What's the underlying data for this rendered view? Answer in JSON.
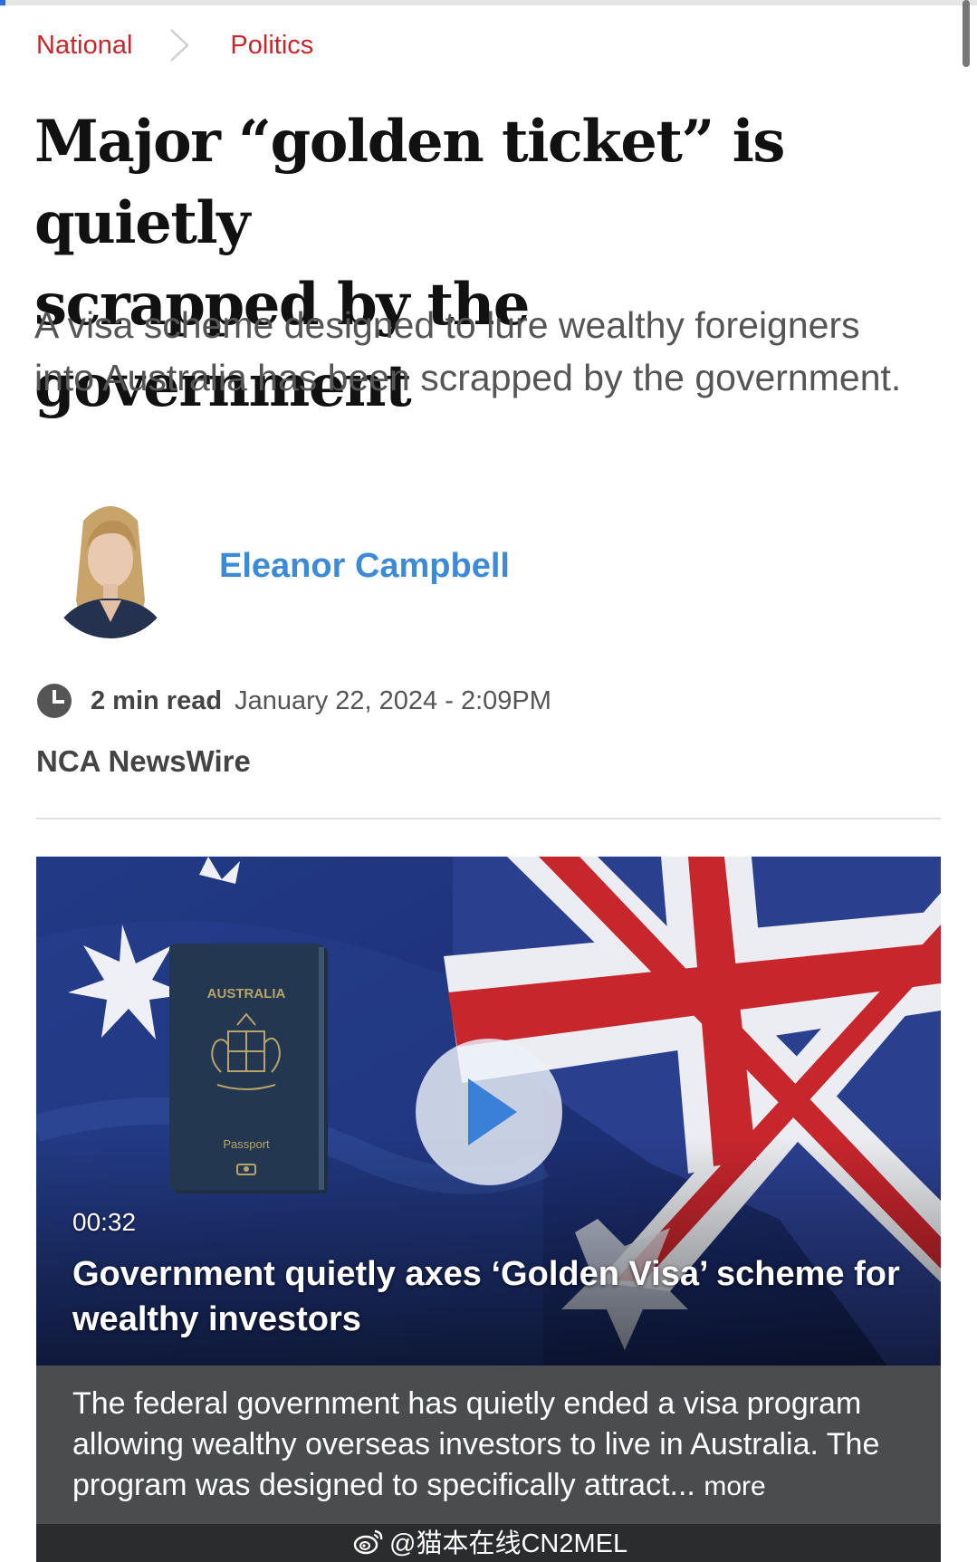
{
  "breadcrumb": {
    "items": [
      "National",
      "Politics"
    ],
    "separator_icon": "chevron-right-icon"
  },
  "article": {
    "headline_line1": "Major “golden ticket” is quietly",
    "headline_line2": "scrapped by the government",
    "standfirst": "A visa scheme designed to lure wealthy foreigners into Australia has been scrapped by the government.",
    "author": "Eleanor Campbell",
    "read_time": "2 min read",
    "published": "January 22, 2024 - 2:09PM",
    "source": "NCA NewsWire"
  },
  "video": {
    "duration": "00:32",
    "title": "Government quietly axes ‘Golden Visa’ scheme for wealthy investors",
    "thumbnail_passport_country": "AUSTRALIA",
    "thumbnail_passport_label": "Passport",
    "caption": "The federal government has quietly ended a visa program allowing wealthy overseas investors to live in Australia. The program was designed to specifically attract...",
    "more_label": "more"
  },
  "watermark": {
    "text": "@猫本在线CN2MEL",
    "icon": "weibo-icon"
  },
  "colors": {
    "breadcrumb": "#c8262d",
    "author_link": "#3d8ad6",
    "caption_bg": "#4b4c4e"
  }
}
